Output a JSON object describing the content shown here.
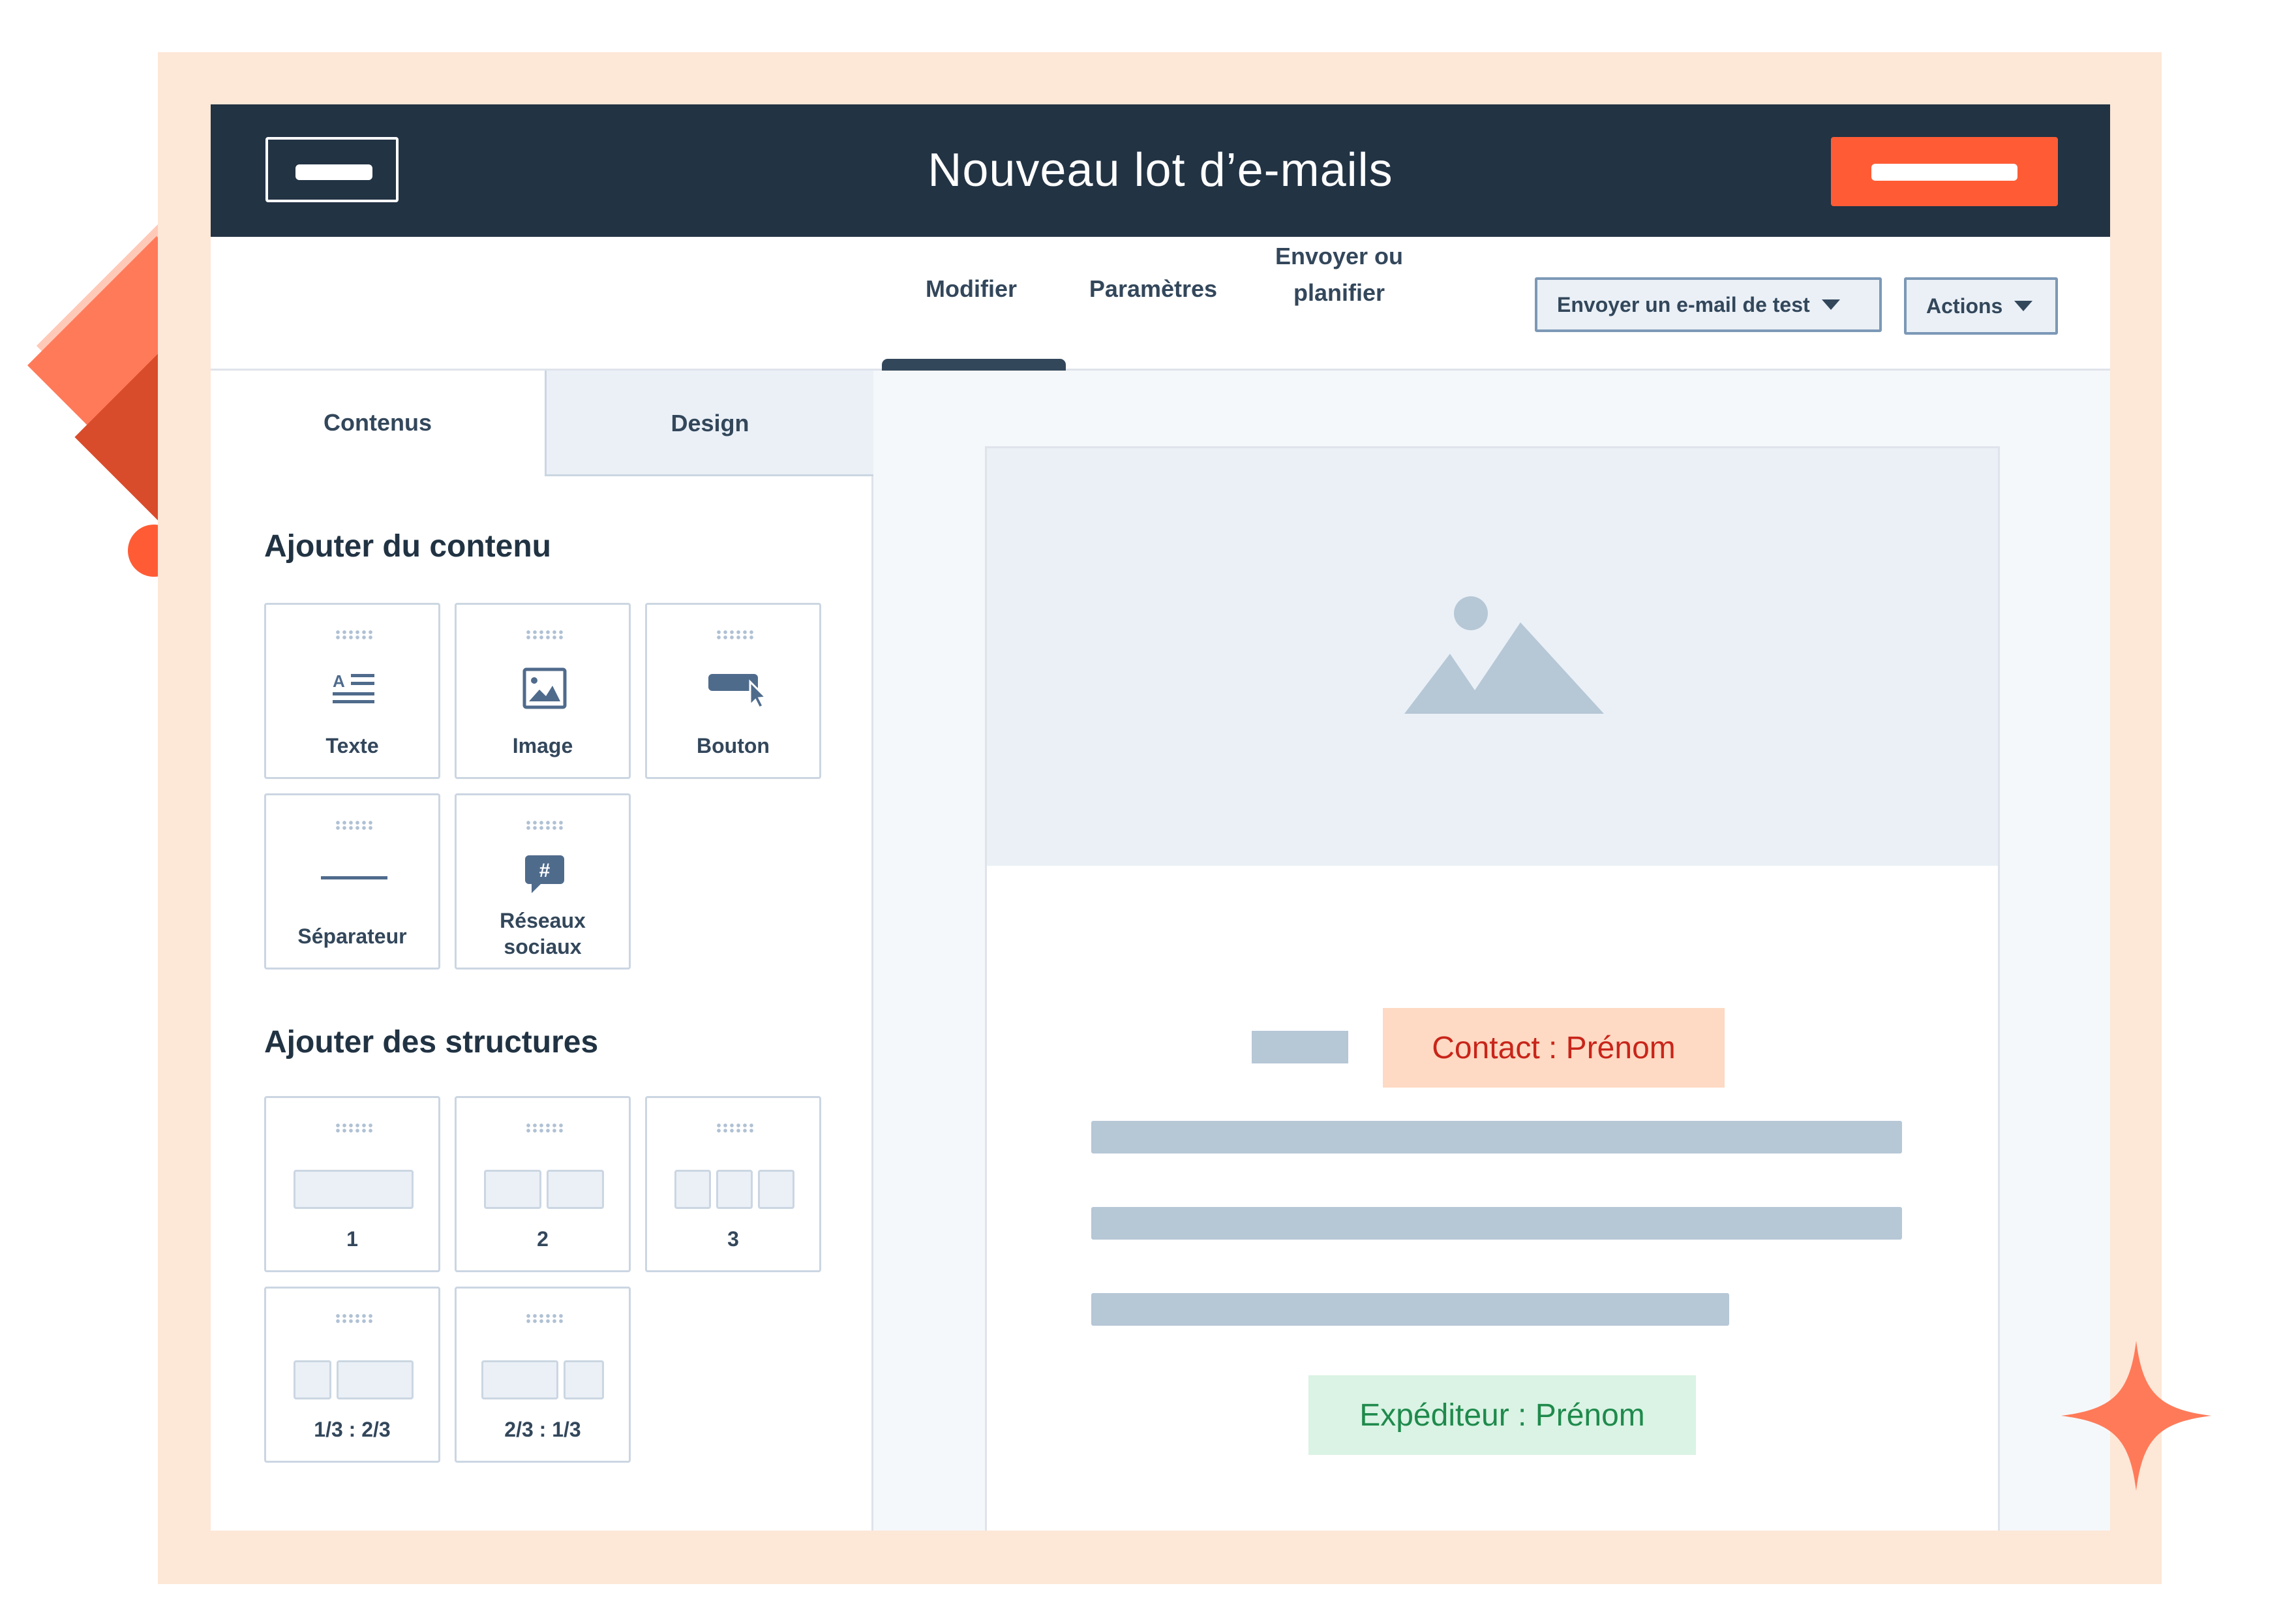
{
  "header": {
    "title": "Nouveau lot d’e-mails"
  },
  "toolbar": {
    "tabs": [
      {
        "label": "Modifier"
      },
      {
        "label": "Paramètres"
      },
      {
        "label_line1": "Envoyer ou",
        "label_line2": "planifier"
      }
    ],
    "test_button": "Envoyer un e-mail de test",
    "actions_button": "Actions"
  },
  "sidebar": {
    "tabs": [
      {
        "label": "Contenus"
      },
      {
        "label": "Design"
      }
    ],
    "content_title": "Ajouter du contenu",
    "content_items": [
      {
        "label": "Texte",
        "icon": "text-icon"
      },
      {
        "label": "Image",
        "icon": "image-icon"
      },
      {
        "label": "Bouton",
        "icon": "button-icon"
      },
      {
        "label": "Séparateur",
        "icon": "divider-icon"
      },
      {
        "label_line1": "Réseaux",
        "label_line2": "sociaux",
        "icon": "social-icon"
      }
    ],
    "structures_title": "Ajouter des structures",
    "structure_items": [
      {
        "label": "1"
      },
      {
        "label": "2"
      },
      {
        "label": "3"
      },
      {
        "label": "1/3 : 2/3"
      },
      {
        "label": "2/3 : 1/3"
      }
    ]
  },
  "preview": {
    "contact_token": "Contact : Prénom",
    "sender_token": "Expéditeur : Prénom"
  },
  "colors": {
    "header_bg": "#223344",
    "accent": "#ff5c35",
    "frame": "#fde7d7",
    "contact_token_bg": "#fed9c3",
    "contact_token_text": "#c8251a",
    "sender_token_bg": "#daf3e4",
    "sender_token_text": "#1f8a4c"
  }
}
